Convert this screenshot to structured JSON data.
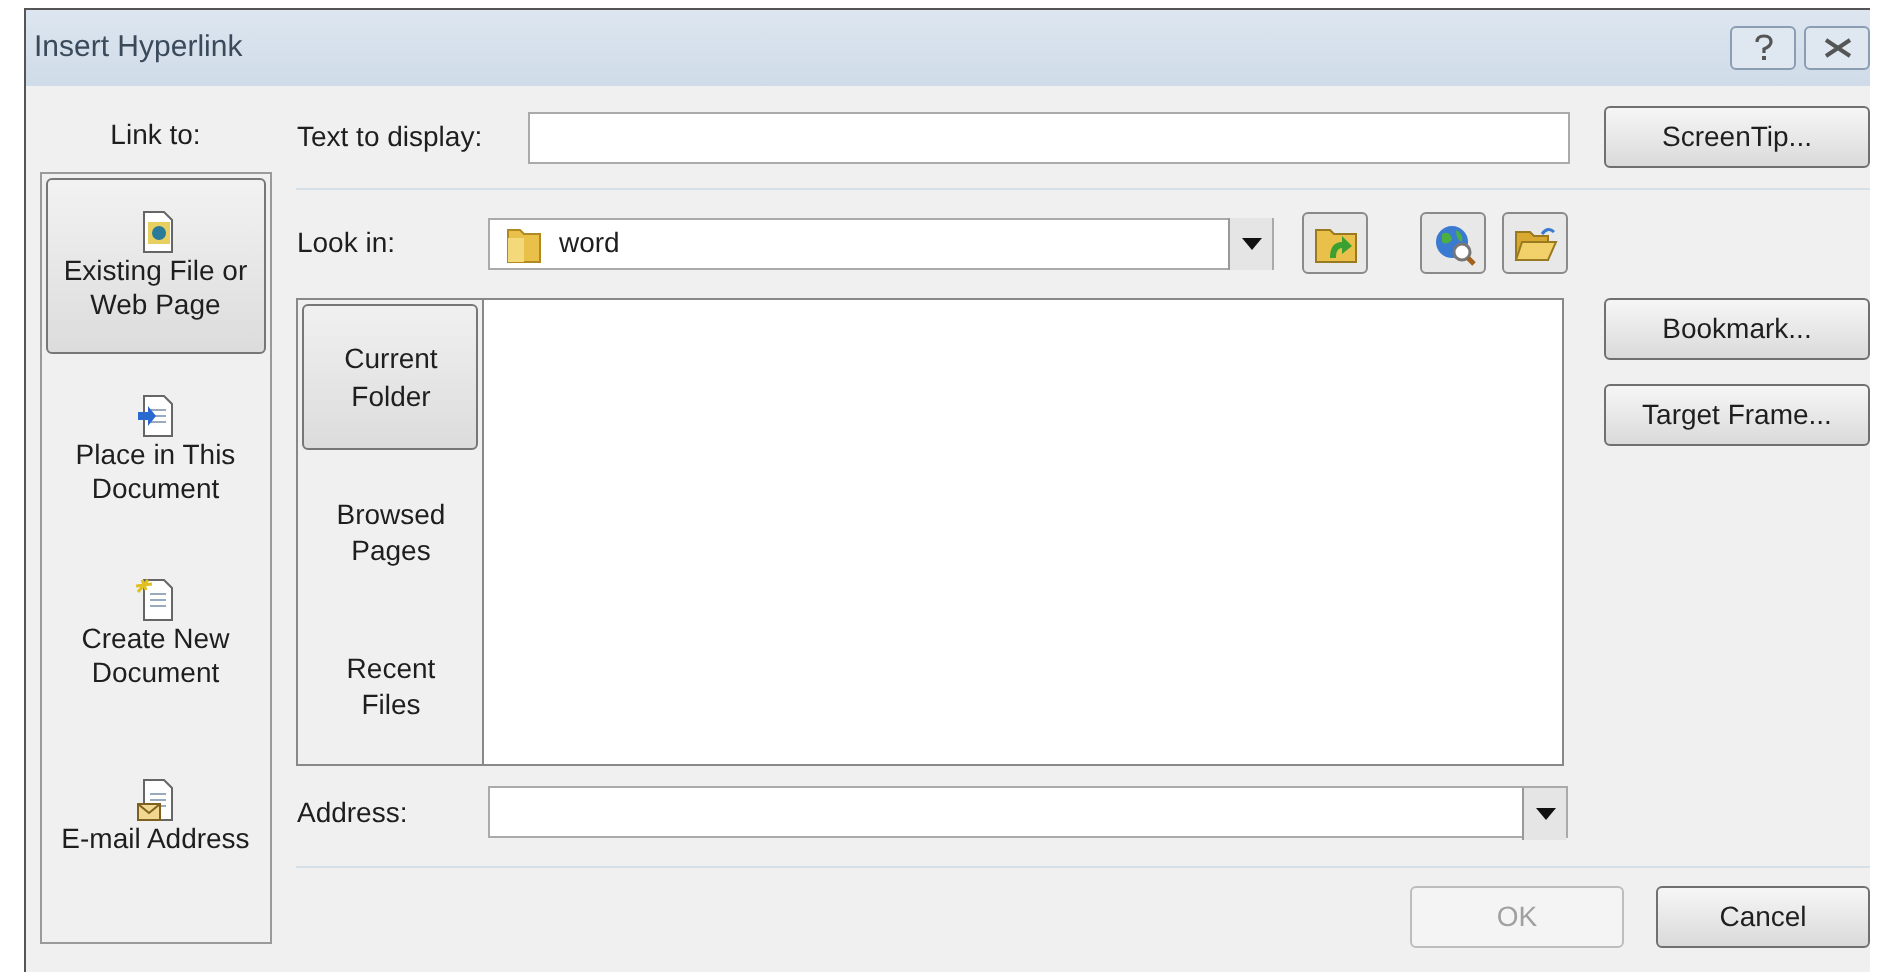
{
  "window": {
    "title": "Insert Hyperlink"
  },
  "link_to": {
    "label": "Link to:",
    "items": [
      {
        "label": "Existing File or Web Page",
        "kind": "existing",
        "selected": true
      },
      {
        "label": "Place in This Document",
        "kind": "place",
        "selected": false
      },
      {
        "label": "Create New Document",
        "kind": "new",
        "selected": false
      },
      {
        "label": "E-mail Address",
        "kind": "email",
        "selected": false
      }
    ]
  },
  "text_to_display": {
    "label": "Text to display:"
  },
  "look_in": {
    "label": "Look in:",
    "value": "word"
  },
  "browse_tabs": [
    {
      "label": "Current Folder",
      "selected": true
    },
    {
      "label": "Browsed Pages",
      "selected": false
    },
    {
      "label": "Recent Files",
      "selected": false
    }
  ],
  "address": {
    "label": "Address:"
  },
  "side_buttons": [
    "ScreenTip...",
    "Bookmark...",
    "Target Frame..."
  ],
  "buttons": [
    {
      "label": "OK",
      "disabled": true
    },
    {
      "label": "Cancel",
      "disabled": false
    }
  ]
}
